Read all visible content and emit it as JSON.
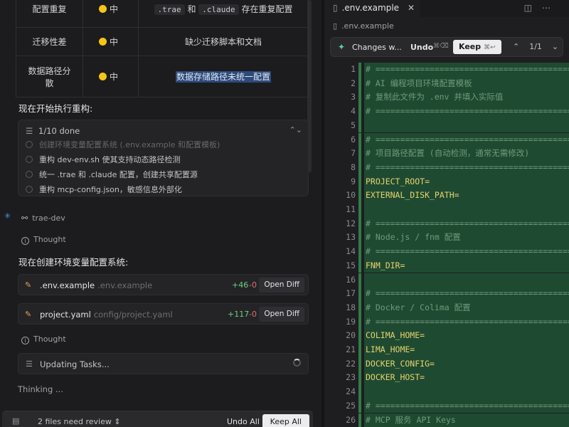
{
  "issues_table": {
    "rows": [
      {
        "name": "配置重复",
        "level": "中",
        "desc_parts": [
          ".trae",
          " 和 ",
          ".claude",
          " 存在重复配置"
        ]
      },
      {
        "name": "迁移性差",
        "level": "中",
        "desc": "缺少迁移脚本和文档"
      },
      {
        "name_lines": [
          "数据路径分",
          "散"
        ],
        "level": "中",
        "desc": "数据存储路径未统一配置"
      }
    ]
  },
  "heading_refactor": "现在开始执行重构:",
  "tasks": {
    "progress": "1/10 done",
    "items": [
      "创建环境变量配置系统 (.env.example 和配置模板)",
      "重构 dev-env.sh 使其支持动态路径检测",
      "统一 .trae 和 .claude 配置，创建共享配置源",
      "重构 mcp-config.json，敏感信息外部化"
    ]
  },
  "agent_name": "trae-dev",
  "thought_label": "Thought",
  "heading_env": "现在创建环境变量配置系统:",
  "files": [
    {
      "name": ".env.example",
      "path": ".env.example",
      "additions": "+46",
      "deletions": "-0",
      "open_label": "Open Diff"
    },
    {
      "name": "project.yaml",
      "path": "config/project.yaml",
      "additions": "+117",
      "deletions": "-0",
      "open_label": "Open Diff"
    }
  ],
  "updating_label": "Updating Tasks...",
  "thinking_label": "Thinking ...",
  "review_bar": {
    "text": "2 files need review",
    "undo_all": "Undo All",
    "keep_all": "Keep All"
  },
  "editor": {
    "tab_name": ".env.example",
    "breadcrumb": ".env.example",
    "changes_label": "Changes w...",
    "undo_label": "Undo",
    "undo_shortcut": "⌘⌫",
    "keep_label": "Keep",
    "keep_shortcut": "⌘↩",
    "change_counter": "1/1",
    "lines": [
      {
        "n": "1",
        "text": "# ==========================================",
        "type": "comment"
      },
      {
        "n": "2",
        "text": "# AI 编程项目环境配置模板",
        "type": "comment"
      },
      {
        "n": "3",
        "text": "# 复制此文件为 .env 并填入实际值",
        "type": "comment"
      },
      {
        "n": "4",
        "text": "# ==========================================",
        "type": "comment"
      },
      {
        "n": "5",
        "text": "",
        "type": "empty"
      },
      {
        "n": "6",
        "text": "# ==========================================",
        "type": "comment"
      },
      {
        "n": "7",
        "text": "# 项目路径配置 (自动检测，通常无需修改)",
        "type": "comment"
      },
      {
        "n": "8",
        "text": "# ==========================================",
        "type": "comment"
      },
      {
        "n": "9",
        "text": "PROJECT_ROOT=",
        "type": "key"
      },
      {
        "n": "10",
        "text": "EXTERNAL_DISK_PATH=",
        "type": "key"
      },
      {
        "n": "11",
        "text": "",
        "type": "empty"
      },
      {
        "n": "12",
        "text": "# ==========================================",
        "type": "comment"
      },
      {
        "n": "13",
        "text": "# Node.js / fnm 配置",
        "type": "comment"
      },
      {
        "n": "14",
        "text": "# ==========================================",
        "type": "comment"
      },
      {
        "n": "15",
        "text": "FNM_DIR=",
        "type": "key"
      },
      {
        "n": "16",
        "text": "",
        "type": "empty"
      },
      {
        "n": "17",
        "text": "# ==========================================",
        "type": "comment"
      },
      {
        "n": "18",
        "text": "# Docker / Colima 配置",
        "type": "comment"
      },
      {
        "n": "19",
        "text": "# ==========================================",
        "type": "comment"
      },
      {
        "n": "20",
        "text": "COLIMA_HOME=",
        "type": "key"
      },
      {
        "n": "21",
        "text": "LIMA_HOME=",
        "type": "key"
      },
      {
        "n": "22",
        "text": "DOCKER_CONFIG=",
        "type": "key"
      },
      {
        "n": "23",
        "text": "DOCKER_HOST=",
        "type": "key"
      },
      {
        "n": "24",
        "text": "",
        "type": "empty"
      },
      {
        "n": "25",
        "text": "# ==========================================",
        "type": "comment"
      },
      {
        "n": "26",
        "text": "# MCP 服务 API Keys",
        "type": "comment"
      }
    ]
  },
  "colors": {
    "added_line_bg": "#1f4a32",
    "added_gutter": "#2f7a4a",
    "warning_dot": "#f5c518",
    "additions": "#6fcf7f",
    "deletions": "#e06c6c"
  }
}
